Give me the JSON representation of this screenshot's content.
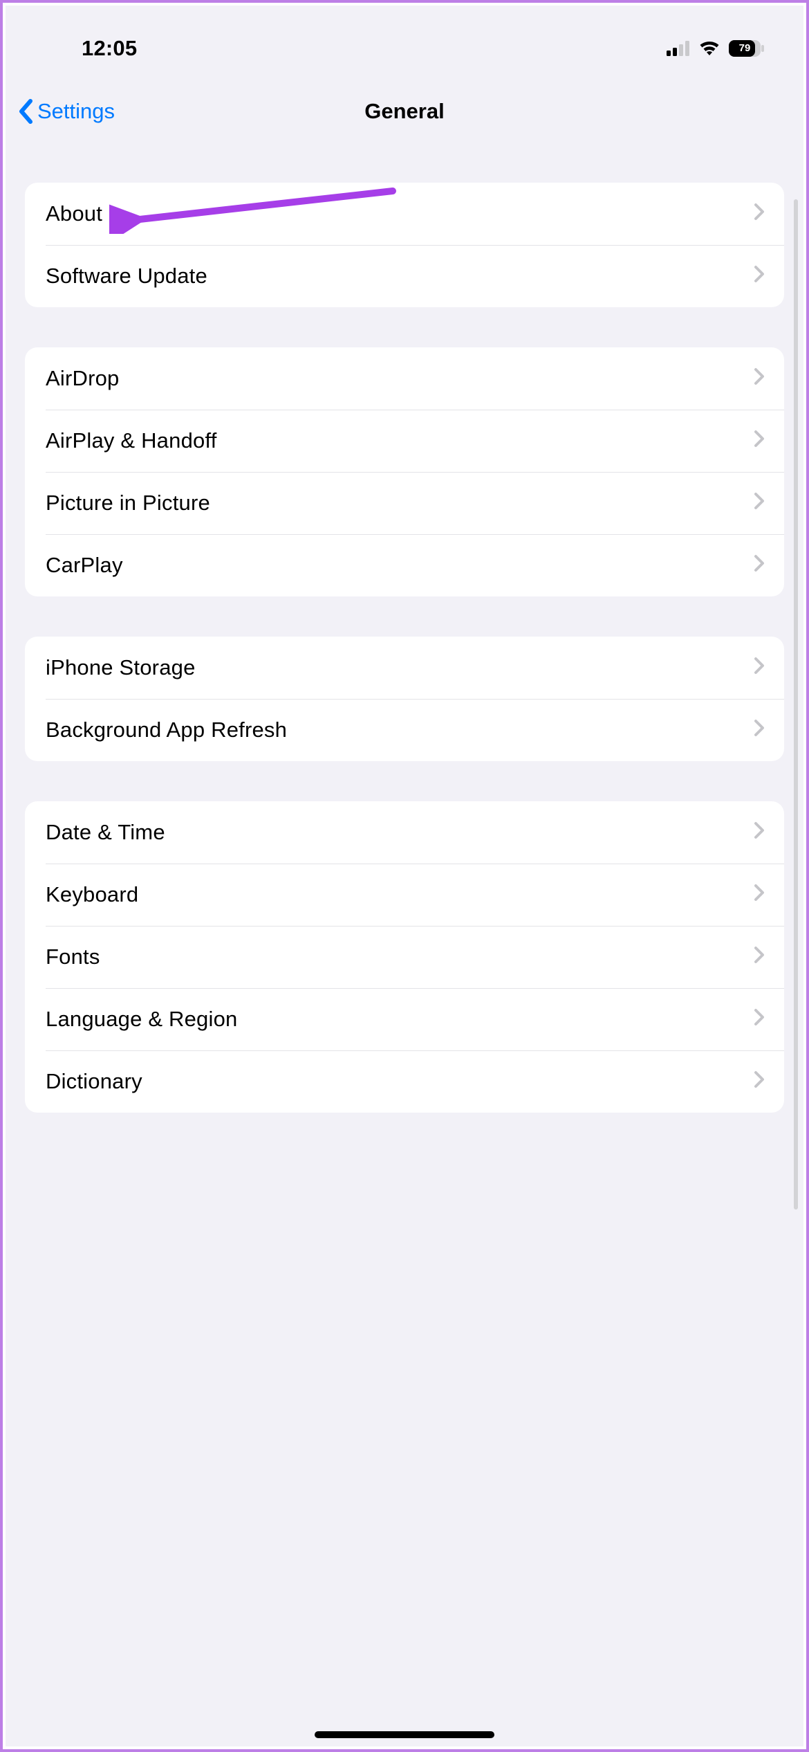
{
  "status": {
    "time": "12:05",
    "battery": "79"
  },
  "nav": {
    "back_label": "Settings",
    "title": "General"
  },
  "groups": [
    {
      "rows": [
        {
          "key": "about",
          "label": "About"
        },
        {
          "key": "software-update",
          "label": "Software Update"
        }
      ]
    },
    {
      "rows": [
        {
          "key": "airdrop",
          "label": "AirDrop"
        },
        {
          "key": "airplay-handoff",
          "label": "AirPlay & Handoff"
        },
        {
          "key": "picture-in-picture",
          "label": "Picture in Picture"
        },
        {
          "key": "carplay",
          "label": "CarPlay"
        }
      ]
    },
    {
      "rows": [
        {
          "key": "iphone-storage",
          "label": "iPhone Storage"
        },
        {
          "key": "background-app-refresh",
          "label": "Background App Refresh"
        }
      ]
    },
    {
      "rows": [
        {
          "key": "date-time",
          "label": "Date & Time"
        },
        {
          "key": "keyboard",
          "label": "Keyboard"
        },
        {
          "key": "fonts",
          "label": "Fonts"
        },
        {
          "key": "language-region",
          "label": "Language & Region"
        },
        {
          "key": "dictionary",
          "label": "Dictionary"
        }
      ]
    }
  ],
  "annotation": {
    "target": "about",
    "color": "#a63ee8"
  }
}
